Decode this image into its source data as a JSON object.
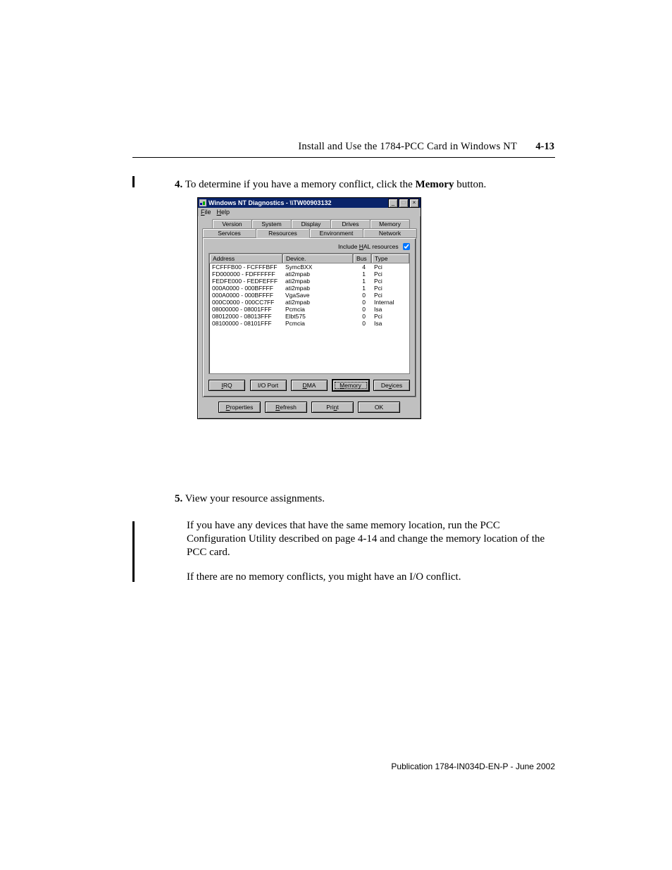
{
  "header": {
    "running_head": "Install and Use the 1784-PCC Card in Windows NT",
    "page_number": "4-13"
  },
  "step4": {
    "number": "4.",
    "text_before": "To determine if you have a memory conflict, click the ",
    "bold": "Memory",
    "text_after": " button."
  },
  "dialog": {
    "title": "Windows NT Diagnostics - \\\\TW00903132",
    "menus": {
      "file": "File",
      "help": "Help"
    },
    "tabs_row1": [
      "Version",
      "System",
      "Display",
      "Drives",
      "Memory"
    ],
    "tabs_row2": [
      "Services",
      "Resources",
      "Environment",
      "Network"
    ],
    "active_tab": "Resources",
    "hal_label": "Include HAL resources",
    "hal_checked": true,
    "columns": {
      "address": "Address",
      "device": "Device.",
      "bus": "Bus",
      "type": "Type"
    },
    "rows": [
      {
        "address": "FCFFFB00 - FCFFFBFF",
        "device": "SymcBXX",
        "bus": "4",
        "type": "Pci"
      },
      {
        "address": "FD000000 - FDFFFFFF",
        "device": "ati2mpab",
        "bus": "1",
        "type": "Pci"
      },
      {
        "address": "FEDFE000 - FEDFEFFF",
        "device": "ati2mpab",
        "bus": "1",
        "type": "Pci"
      },
      {
        "address": "000A0000 - 000BFFFF",
        "device": "ati2mpab",
        "bus": "1",
        "type": "Pci"
      },
      {
        "address": "000A0000 - 000BFFFF",
        "device": "VgaSave",
        "bus": "0",
        "type": "Pci"
      },
      {
        "address": "000C0000 - 000CC7FF",
        "device": "ati2mpab",
        "bus": "0",
        "type": "Internal"
      },
      {
        "address": "08000000 - 08001FFF",
        "device": "Pcmcia",
        "bus": "0",
        "type": "Isa"
      },
      {
        "address": "08012000 - 08013FFF",
        "device": "Elbt575",
        "bus": "0",
        "type": "Pci"
      },
      {
        "address": "08100000 - 08101FFF",
        "device": "Pcmcia",
        "bus": "0",
        "type": "Isa"
      }
    ],
    "category_buttons": {
      "irq": "IRQ",
      "io": "I/O Port",
      "dma": "DMA",
      "memory": "Memory",
      "devices": "Devices"
    },
    "bottom_buttons": {
      "properties": "Properties",
      "refresh": "Refresh",
      "print": "Print",
      "ok": "OK"
    }
  },
  "step5": {
    "number": "5.",
    "text": "View your resource assignments."
  },
  "para1": "If you have any devices that have the same memory location, run the PCC Configuration Utility described on page 4-14 and change the memory location of the PCC card.",
  "para2": "If there are no memory conflicts, you might have an I/O conflict.",
  "footer": "Publication 1784-IN034D-EN-P - June 2002"
}
